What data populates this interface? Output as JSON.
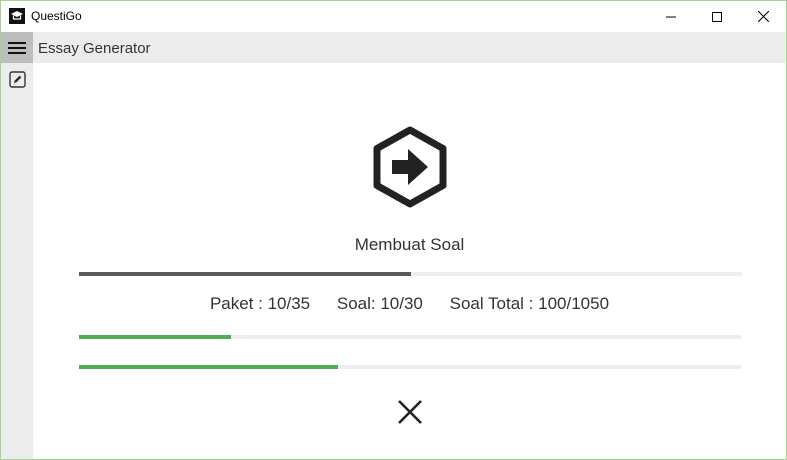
{
  "window": {
    "title": "QuestiGo",
    "minimize_icon": "minimize-icon",
    "maximize_icon": "maximize-icon",
    "close_icon": "close-icon"
  },
  "header": {
    "menu_icon": "hamburger-menu-icon",
    "title": "Essay Generator"
  },
  "sidebar": {
    "items": [
      {
        "icon": "edit-icon"
      }
    ]
  },
  "main": {
    "hero_icon": "hexagon-arrow-right-icon",
    "status_label": "Membuat Soal",
    "main_progress": 0.5,
    "stats": {
      "paket": "Paket : 10/35",
      "soal": "Soal: 10/30",
      "soal_total": "Soal Total : 100/1050"
    },
    "paket_progress": 0.23,
    "total_progress": 0.39,
    "cancel_icon": "cancel-x-icon"
  },
  "colors": {
    "accent_green": "#4caf50",
    "progress_dark": "#5a5a5a",
    "track": "#eeeeee",
    "chrome": "#ececec"
  }
}
